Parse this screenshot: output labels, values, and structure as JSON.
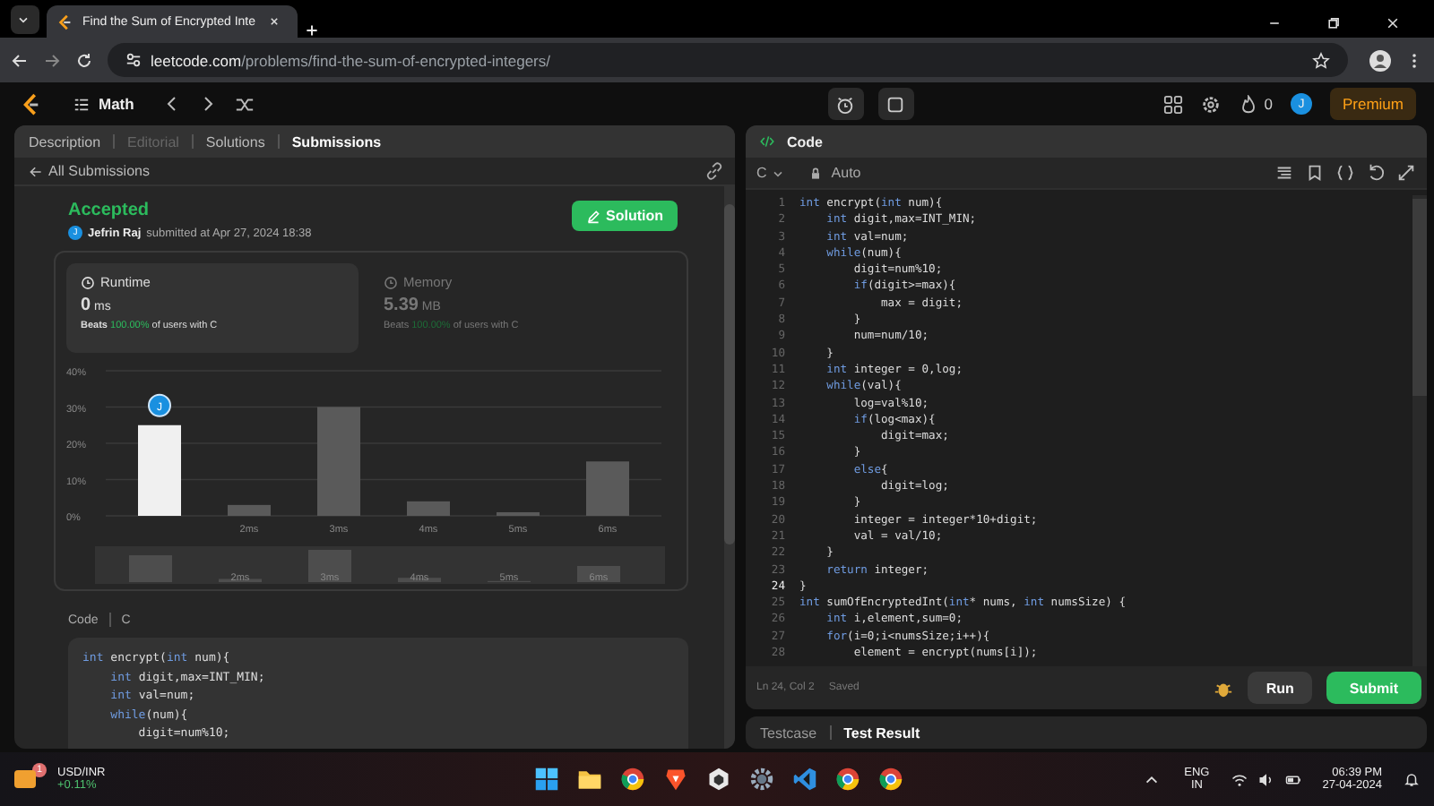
{
  "browser": {
    "tab_title": "Find the Sum of Encrypted Inte",
    "url_host": "leetcode.com",
    "url_path": "/problems/find-the-sum-of-encrypted-integers/"
  },
  "nav": {
    "problem_list": "Math",
    "streak": "0",
    "avatar": "J",
    "premium": "Premium"
  },
  "left_tabs": [
    {
      "label": "Description",
      "selected": false,
      "disabled": false
    },
    {
      "label": "Editorial",
      "selected": false,
      "disabled": true
    },
    {
      "label": "Solutions",
      "selected": false,
      "disabled": false
    },
    {
      "label": "Submissions",
      "selected": true,
      "disabled": false
    }
  ],
  "back_link": "All Submissions",
  "submission": {
    "status": "Accepted",
    "avatar": "J",
    "author": "Jefrin Raj",
    "submitted": "submitted at Apr 27, 2024 18:38",
    "solution_button": "Solution"
  },
  "stats": [
    {
      "label": "Runtime",
      "value": "0",
      "unit": "ms",
      "beats_label": "Beats",
      "beats": "100.00%",
      "suffix": "of users with C",
      "selected": true
    },
    {
      "label": "Memory",
      "value": "5.39",
      "unit": "MB",
      "beats_label": "Beats",
      "beats": "100.00%",
      "suffix": "of users with C",
      "selected": false
    }
  ],
  "chart_data": {
    "type": "bar",
    "categories": [
      null,
      "2ms",
      "3ms",
      "4ms",
      "5ms",
      "6ms"
    ],
    "grid": true,
    "series": [
      {
        "color": "#f0f0f0",
        "values": [
          25,
          null,
          null,
          null,
          null,
          null
        ]
      },
      {
        "color": "#5a5a5a",
        "values": [
          null,
          3,
          30,
          4,
          1,
          15
        ]
      }
    ],
    "ylim": [
      0,
      40
    ],
    "yticks": [
      {
        "value": 0,
        "label": "0%"
      },
      {
        "value": 10,
        "label": "10%"
      },
      {
        "value": 20,
        "label": "20%"
      },
      {
        "value": 30,
        "label": "30%"
      },
      {
        "value": 40,
        "label": "40%"
      }
    ]
  },
  "chart_marker": "J",
  "overview_labels": [
    "2ms",
    "3ms",
    "4ms",
    "5ms",
    "6ms"
  ],
  "code_view": {
    "label": "Code",
    "language": "C",
    "lines": [
      "int encrypt(int num){",
      "    int digit,max=INT_MIN;",
      "    int val=num;",
      "    while(num){",
      "        digit=num%10;"
    ]
  },
  "editor": {
    "title": "Code",
    "language": "C",
    "mode": "Auto",
    "lines": [
      {
        "number": "1",
        "code": "int encrypt(int num){",
        "selected": false
      },
      {
        "number": "2",
        "code": "    int digit,max=INT_MIN;",
        "selected": false
      },
      {
        "number": "3",
        "code": "    int val=num;",
        "selected": false
      },
      {
        "number": "4",
        "code": "    while(num){",
        "selected": false
      },
      {
        "number": "5",
        "code": "        digit=num%10;",
        "selected": false
      },
      {
        "number": "6",
        "code": "        if(digit>=max){",
        "selected": false
      },
      {
        "number": "7",
        "code": "            max = digit;",
        "selected": false
      },
      {
        "number": "8",
        "code": "        }",
        "selected": false
      },
      {
        "number": "9",
        "code": "        num=num/10;",
        "selected": false
      },
      {
        "number": "10",
        "code": "    }",
        "selected": false
      },
      {
        "number": "11",
        "code": "    int integer = 0,log;",
        "selected": false
      },
      {
        "number": "12",
        "code": "    while(val){",
        "selected": false
      },
      {
        "number": "13",
        "code": "        log=val%10;",
        "selected": false
      },
      {
        "number": "14",
        "code": "        if(log<max){",
        "selected": false
      },
      {
        "number": "15",
        "code": "            digit=max;",
        "selected": false
      },
      {
        "number": "16",
        "code": "        }",
        "selected": false
      },
      {
        "number": "17",
        "code": "        else{",
        "selected": false
      },
      {
        "number": "18",
        "code": "            digit=log;",
        "selected": false
      },
      {
        "number": "19",
        "code": "        }",
        "selected": false
      },
      {
        "number": "20",
        "code": "        integer = integer*10+digit;",
        "selected": false
      },
      {
        "number": "21",
        "code": "        val = val/10;",
        "selected": false
      },
      {
        "number": "22",
        "code": "    }",
        "selected": false
      },
      {
        "number": "23",
        "code": "    return integer;",
        "selected": false
      },
      {
        "number": "24",
        "code": "}",
        "selected": true
      },
      {
        "number": "25",
        "code": "int sumOfEncryptedInt(int* nums, int numsSize) {",
        "selected": false
      },
      {
        "number": "26",
        "code": "    int i,element,sum=0;",
        "selected": false
      },
      {
        "number": "27",
        "code": "    for(i=0;i<numsSize;i++){",
        "selected": false
      },
      {
        "number": "28",
        "code": "        element = encrypt(nums[i]);",
        "selected": false
      }
    ],
    "status": "Ln 24, Col 2",
    "saved": "Saved",
    "run": "Run",
    "submit": "Submit"
  },
  "bottom_tabs": [
    {
      "label": "Testcase",
      "selected": false
    },
    {
      "label": "Test Result",
      "selected": true
    }
  ],
  "taskbar": {
    "ticker": "USD/INR",
    "change": "+0.11%",
    "notification_count": "1",
    "lang": "ENG",
    "region": "IN",
    "time": "06:39 PM",
    "date": "27-04-2024"
  }
}
